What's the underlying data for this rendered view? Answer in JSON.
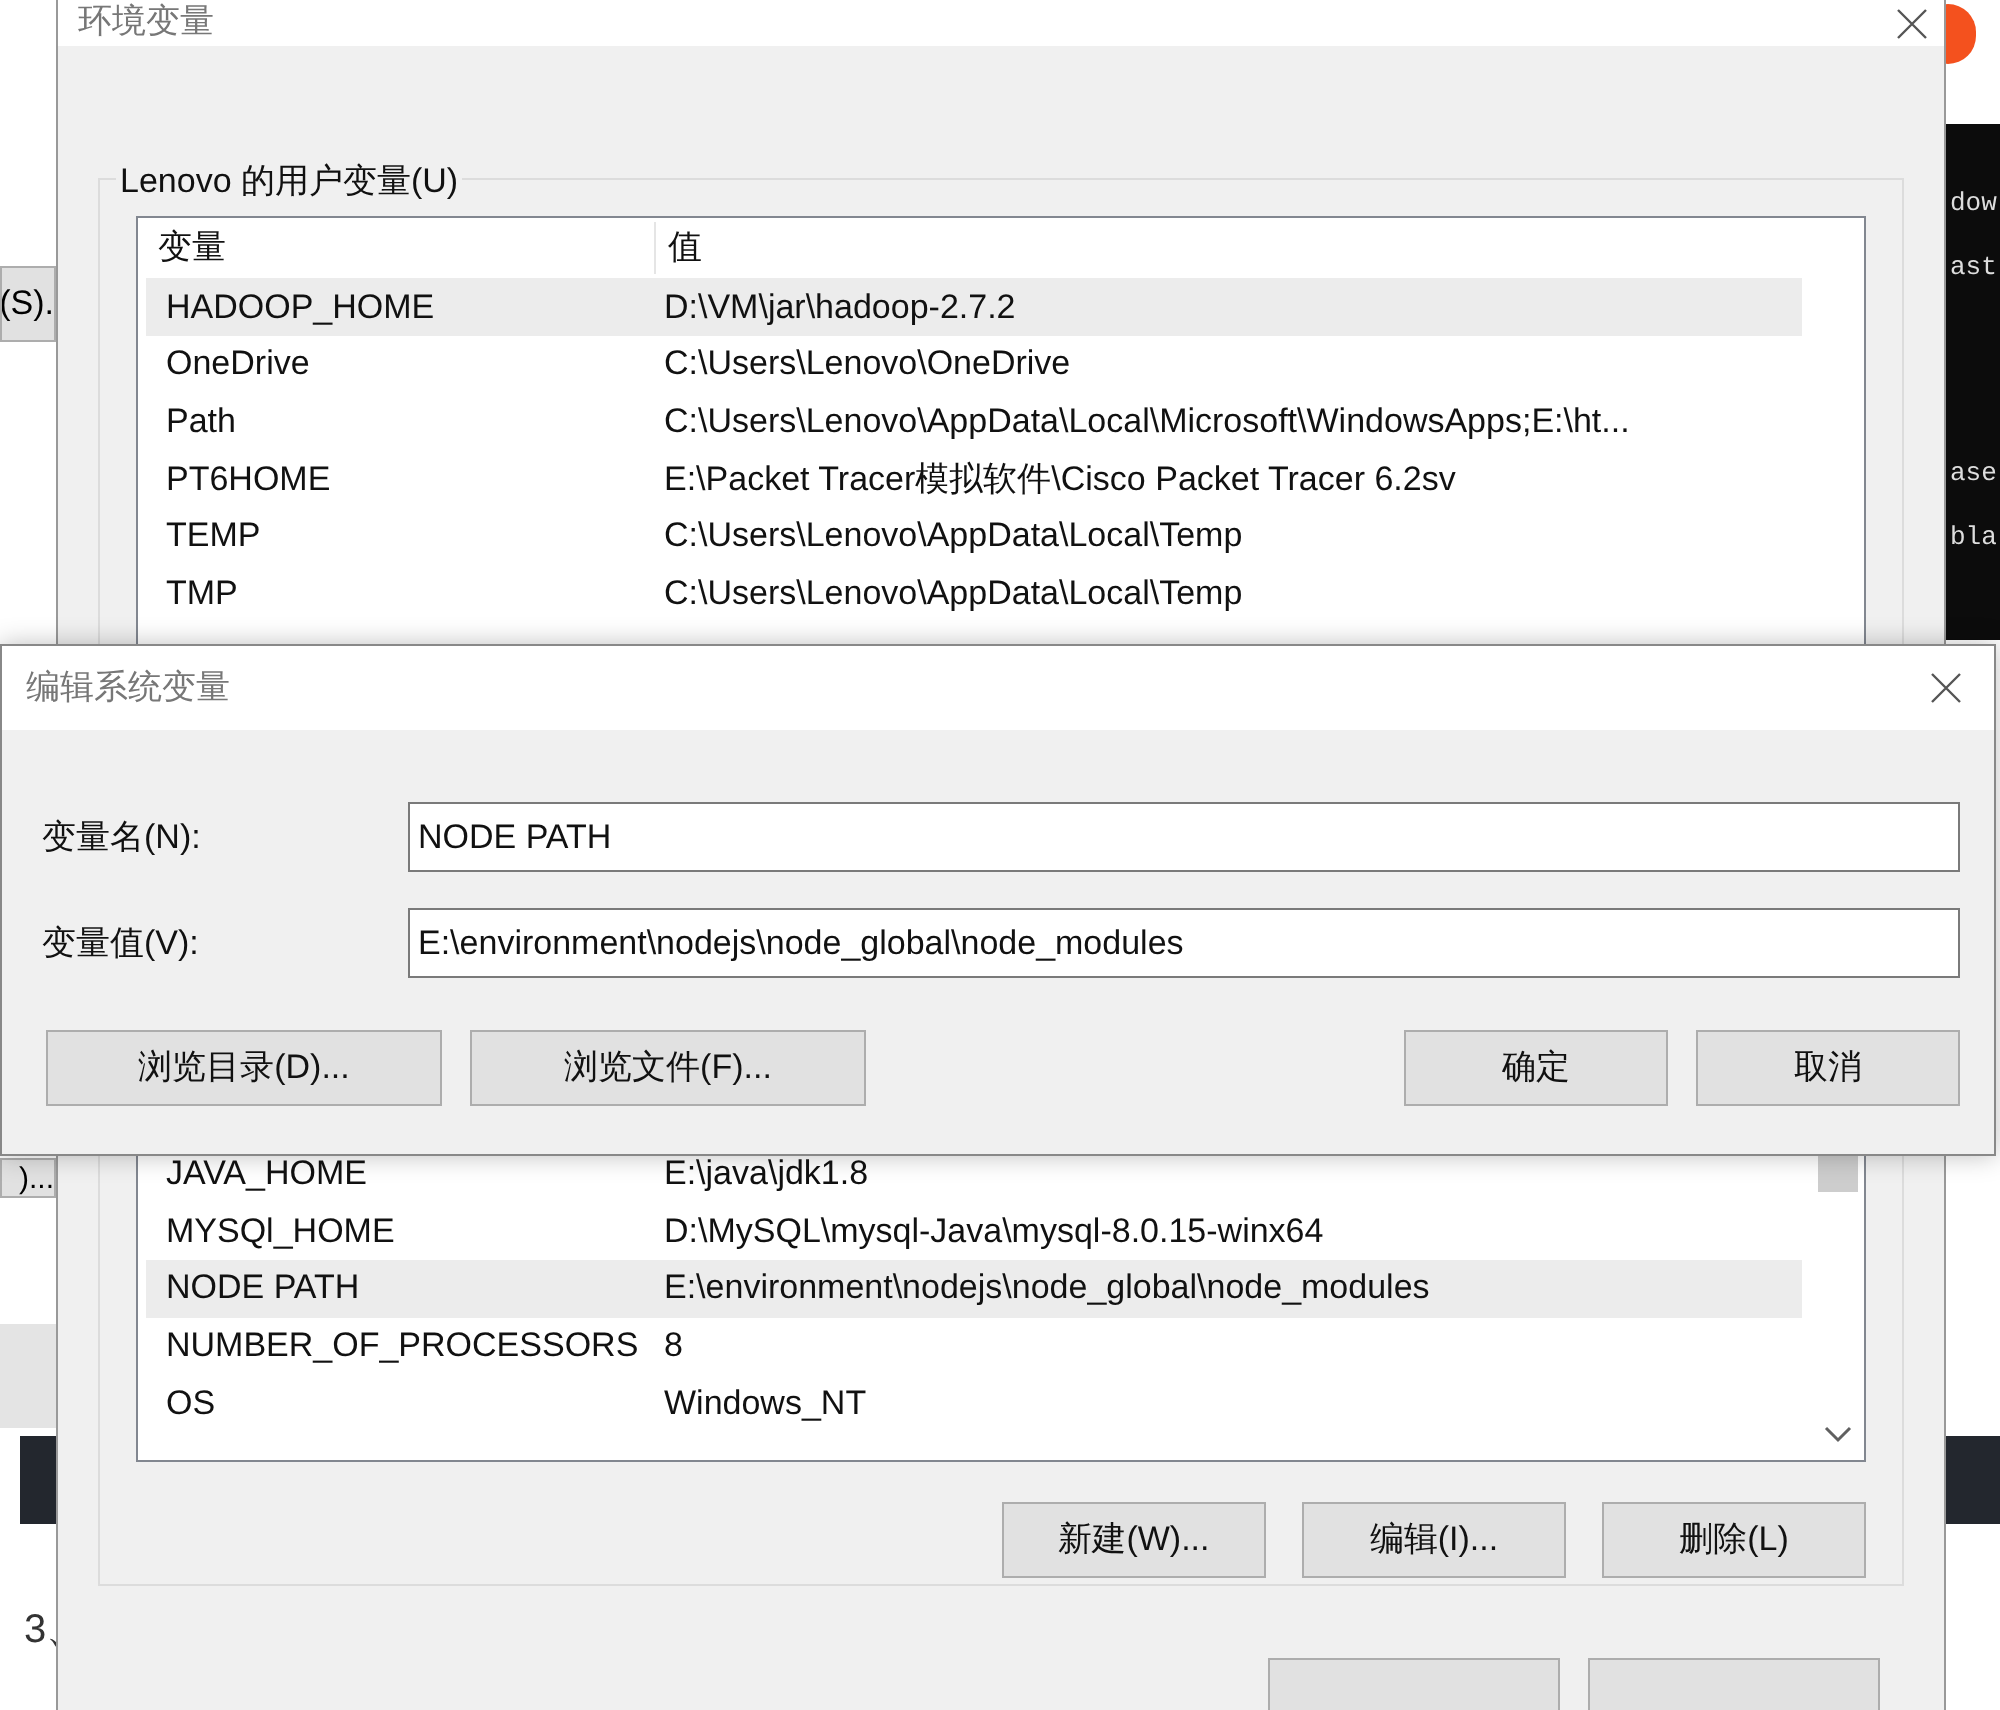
{
  "background": {
    "left_buttons": [
      "(S).",
      ")..."
    ],
    "step_number": "3、",
    "terminal_lines": [
      "dow",
      "ast",
      "ase",
      "bla"
    ]
  },
  "env_window": {
    "title": "环境变量",
    "user_group": {
      "legend": "Lenovo 的用户变量(U)",
      "columns": [
        "变量",
        "值"
      ],
      "rows": [
        {
          "name": "HADOOP_HOME",
          "value": "D:\\VM\\jar\\hadoop-2.7.2",
          "selected": true
        },
        {
          "name": "OneDrive",
          "value": "C:\\Users\\Lenovo\\OneDrive",
          "selected": false
        },
        {
          "name": "Path",
          "value": "C:\\Users\\Lenovo\\AppData\\Local\\Microsoft\\WindowsApps;E:\\ht...",
          "selected": false
        },
        {
          "name": "PT6HOME",
          "value": "E:\\Packet Tracer模拟软件\\Cisco Packet Tracer 6.2sv",
          "selected": false
        },
        {
          "name": "TEMP",
          "value": "C:\\Users\\Lenovo\\AppData\\Local\\Temp",
          "selected": false
        },
        {
          "name": "TMP",
          "value": "C:\\Users\\Lenovo\\AppData\\Local\\Temp",
          "selected": false
        }
      ]
    },
    "system_group": {
      "rows": [
        {
          "name": "JAVA_HOME",
          "value": "E:\\java\\jdk1.8",
          "selected": false
        },
        {
          "name": "MYSQl_HOME",
          "value": "D:\\MySQL\\mysql-Java\\mysql-8.0.15-winx64",
          "selected": false
        },
        {
          "name": "NODE PATH",
          "value": "E:\\environment\\nodejs\\node_global\\node_modules",
          "selected": true
        },
        {
          "name": "NUMBER_OF_PROCESSORS",
          "value": "8",
          "selected": false
        },
        {
          "name": "OS",
          "value": "Windows_NT",
          "selected": false
        }
      ],
      "buttons": [
        "新建(W)...",
        "编辑(I)...",
        "删除(L)"
      ]
    }
  },
  "edit_dialog": {
    "title": "编辑系统变量",
    "fields": [
      {
        "label": "变量名(N):",
        "value": "NODE PATH"
      },
      {
        "label": "变量值(V):",
        "value": "E:\\environment\\nodejs\\node_global\\node_modules"
      }
    ],
    "left_buttons": [
      "浏览目录(D)...",
      "浏览文件(F)..."
    ],
    "right_buttons": [
      "确定",
      "取消"
    ]
  }
}
